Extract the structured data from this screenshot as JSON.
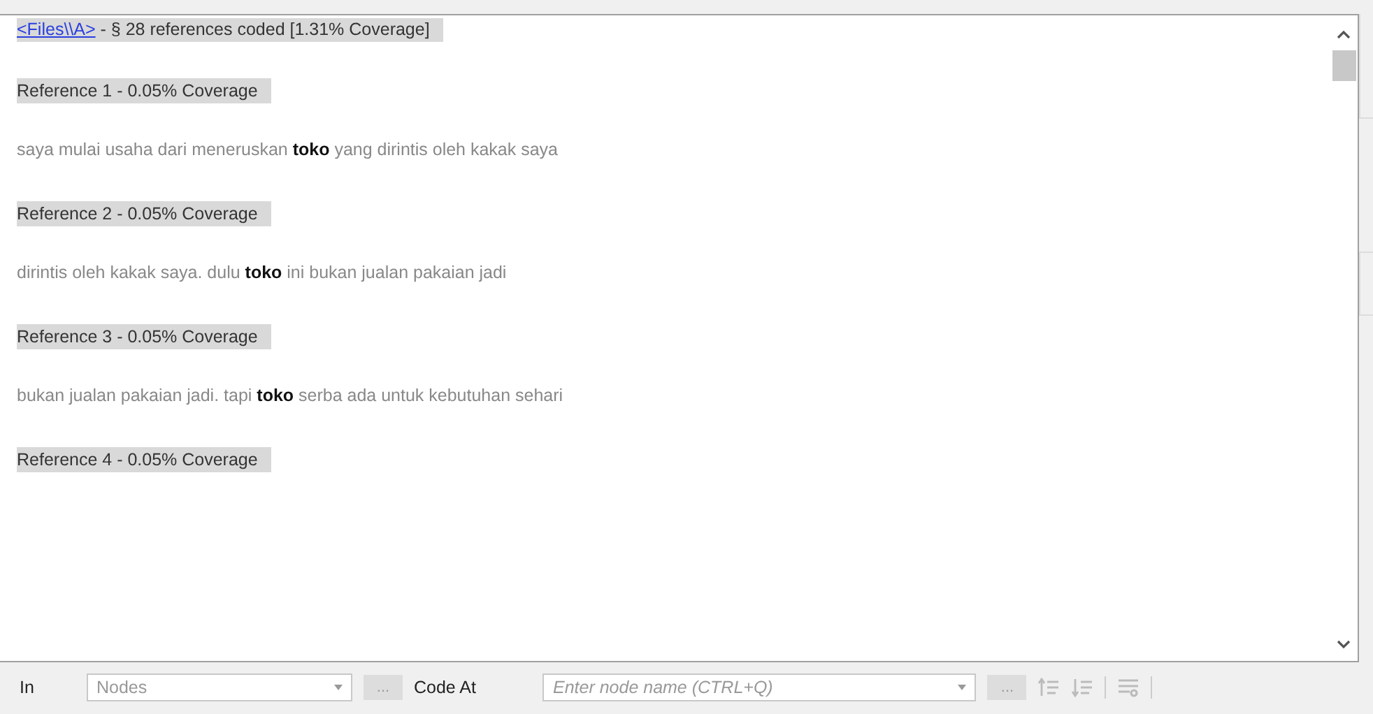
{
  "header": {
    "link": "<Files\\\\A>",
    "text": " - § 28 references coded  [1.31% Coverage]"
  },
  "references": [
    {
      "heading": "Reference 1 - 0.05% Coverage",
      "text": "saya mulai usaha dari meneruskan **toko** yang dirintis oleh kakak saya"
    },
    {
      "heading": "Reference 2 - 0.05% Coverage",
      "text": "dirintis oleh kakak saya. dulu **toko** ini bukan jualan pakaian jadi"
    },
    {
      "heading": "Reference 3 - 0.05% Coverage",
      "text": "bukan jualan pakaian jadi. tapi **toko** serba ada untuk kebutuhan sehari"
    },
    {
      "heading": "Reference 4 - 0.05% Coverage"
    }
  ],
  "coding_bar": {
    "in_label": "In",
    "nodes_placeholder": "Nodes",
    "browse_label": "...",
    "code_at_label": "Code At",
    "node_placeholder": "Enter node name (CTRL+Q)",
    "browse2_label": "..."
  }
}
